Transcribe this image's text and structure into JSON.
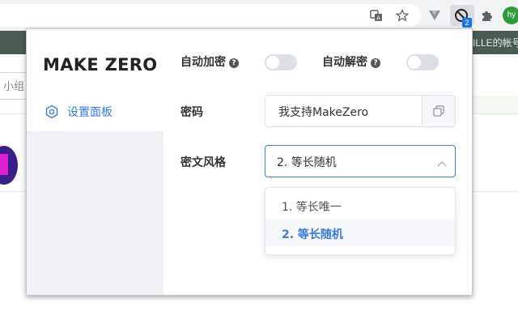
{
  "browser": {
    "extension_badge": "2",
    "profile_initials": "hy"
  },
  "background_page": {
    "header_right_text": "ILLE的帐号",
    "left_input_fragment": "小组"
  },
  "popup": {
    "brand": "MAKE ZERO",
    "sidebar": {
      "items": [
        {
          "label": "设置面板",
          "icon": "gear-icon"
        }
      ]
    },
    "auto_encrypt": {
      "label": "自动加密",
      "help": "?",
      "enabled": false
    },
    "auto_decrypt": {
      "label": "自动解密",
      "help": "?",
      "enabled": false
    },
    "password": {
      "label": "密码",
      "value": "我支持MakeZero",
      "copy_icon": "copy-icon"
    },
    "cipher_style": {
      "label": "密文风格",
      "selected": "2. 等长随机",
      "options": [
        "1. 等长唯一",
        "2. 等长随机"
      ]
    }
  },
  "colors": {
    "accent": "#3a7bdc",
    "sidebar_bg": "#eef0f4",
    "toggle_off": "#dcdfe6",
    "page_header": "#4a5b52"
  }
}
